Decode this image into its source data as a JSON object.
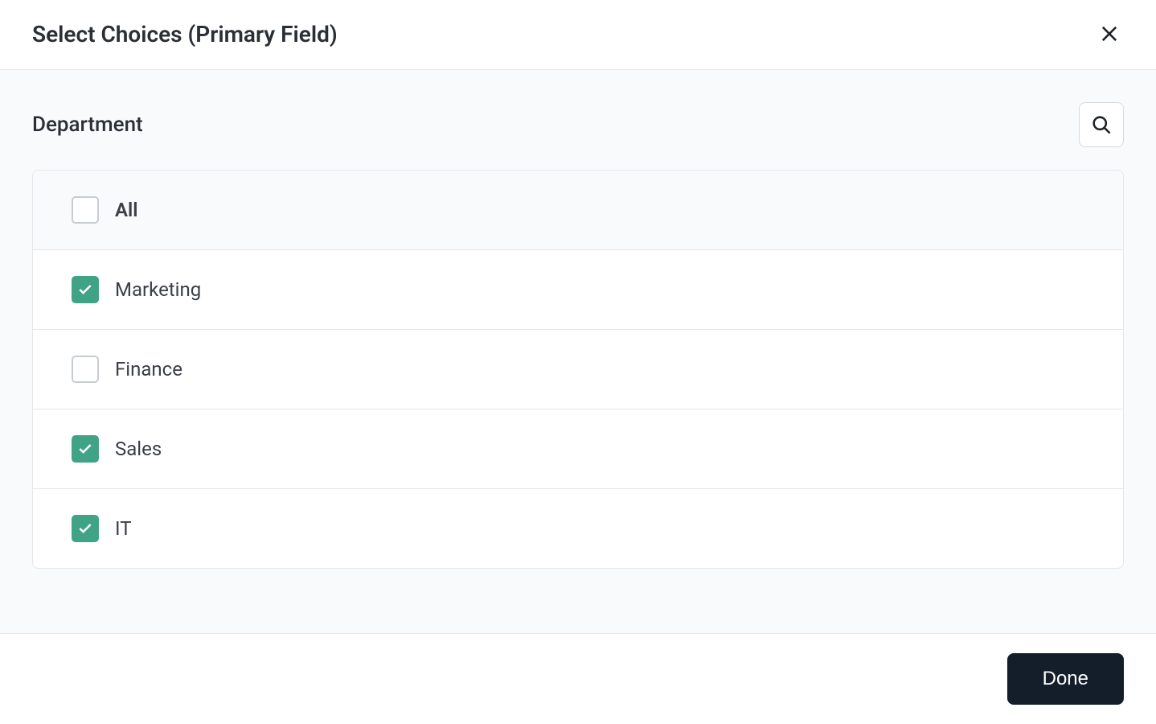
{
  "modal": {
    "title": "Select Choices (Primary Field)",
    "field_label": "Department",
    "all_label": "All",
    "all_checked": false,
    "choices": [
      {
        "label": "Marketing",
        "checked": true
      },
      {
        "label": "Finance",
        "checked": false
      },
      {
        "label": "Sales",
        "checked": true
      },
      {
        "label": "IT",
        "checked": true
      }
    ],
    "done_label": "Done"
  }
}
